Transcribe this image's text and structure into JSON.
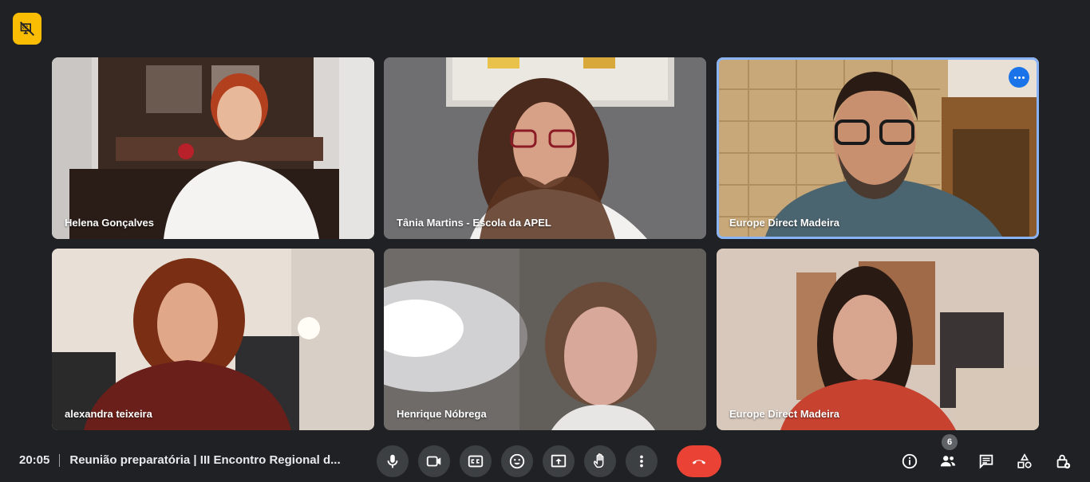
{
  "meeting": {
    "time": "20:05",
    "title": "Reunião preparatória | III Encontro Regional d..."
  },
  "participants": [
    {
      "name": "Helena Gonçalves",
      "active": false
    },
    {
      "name": "Tânia Martins - Escola da APEL",
      "active": false
    },
    {
      "name": "Europe Direct Madeira",
      "active": true
    },
    {
      "name": "alexandra teixeira",
      "active": false
    },
    {
      "name": "Henrique Nóbrega",
      "active": false
    },
    {
      "name": "Europe Direct Madeira",
      "active": false
    }
  ],
  "participants_count": "6",
  "icons": {
    "top_badge": "no-video-stream-icon",
    "controls": [
      "microphone-icon",
      "camera-icon",
      "captions-icon",
      "emoji-icon",
      "present-screen-icon",
      "raise-hand-icon",
      "more-options-icon",
      "end-call-icon"
    ],
    "right": [
      "info-icon",
      "people-icon",
      "chat-icon",
      "activities-icon",
      "host-controls-icon"
    ]
  },
  "colors": {
    "background": "#202124",
    "control_bg": "#3c4043",
    "end_call": "#ea4335",
    "active_border": "#8ab4f8",
    "badge_yellow": "#fbbc04"
  }
}
